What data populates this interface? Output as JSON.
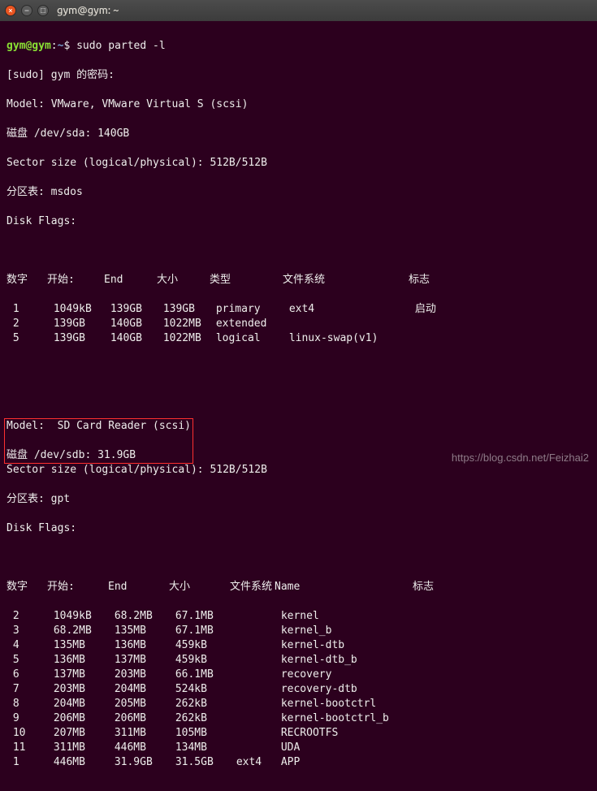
{
  "titlebar": {
    "title": "gym@gym: ~"
  },
  "prompt": {
    "userhost": "gym@gym",
    "sep": ":",
    "path": "~",
    "sigil": "$"
  },
  "command": "sudo parted -l",
  "sudo_line": "[sudo] gym 的密码:",
  "disk1": {
    "model": "Model: VMware, VMware Virtual S (scsi)",
    "disk": "磁盘 /dev/sda: 140GB",
    "sector": "Sector size (logical/physical): 512B/512B",
    "ptable": "分区表: msdos",
    "flags": "Disk Flags:",
    "headers": {
      "num": "数字",
      "start": "开始:",
      "end": "End",
      "size": "大小",
      "type": "类型",
      "fs": "文件系统",
      "flags": "标志"
    },
    "rows": [
      {
        "num": "1",
        "start": "1049kB",
        "end": "139GB",
        "size": "139GB",
        "type": "primary",
        "fs": "ext4",
        "flags": "启动"
      },
      {
        "num": "2",
        "start": "139GB",
        "end": "140GB",
        "size": "1022MB",
        "type": "extended",
        "fs": "",
        "flags": ""
      },
      {
        "num": "5",
        "start": "139GB",
        "end": "140GB",
        "size": "1022MB",
        "type": "logical",
        "fs": "linux-swap(v1)",
        "flags": ""
      }
    ]
  },
  "disk2": {
    "model": "Model:  SD Card Reader (scsi)",
    "disk": "磁盘 /dev/sdb: 31.9GB",
    "sector": "Sector size (logical/physical): 512B/512B",
    "ptable": "分区表: gpt",
    "flags": "Disk Flags:",
    "headers": {
      "num": "数字",
      "start": "开始:",
      "end": "End",
      "size": "大小",
      "fs": "文件系统",
      "name": "Name",
      "flags": "标志"
    },
    "rows": [
      {
        "num": "2",
        "start": "1049kB",
        "end": "68.2MB",
        "size": "67.1MB",
        "fs": "",
        "name": "kernel"
      },
      {
        "num": "3",
        "start": "68.2MB",
        "end": "135MB",
        "size": "67.1MB",
        "fs": "",
        "name": "kernel_b"
      },
      {
        "num": "4",
        "start": "135MB",
        "end": "136MB",
        "size": "459kB",
        "fs": "",
        "name": "kernel-dtb"
      },
      {
        "num": "5",
        "start": "136MB",
        "end": "137MB",
        "size": "459kB",
        "fs": "",
        "name": "kernel-dtb_b"
      },
      {
        "num": "6",
        "start": "137MB",
        "end": "203MB",
        "size": "66.1MB",
        "fs": "",
        "name": "recovery"
      },
      {
        "num": "7",
        "start": "203MB",
        "end": "204MB",
        "size": "524kB",
        "fs": "",
        "name": "recovery-dtb"
      },
      {
        "num": "8",
        "start": "204MB",
        "end": "205MB",
        "size": "262kB",
        "fs": "",
        "name": "kernel-bootctrl"
      },
      {
        "num": "9",
        "start": "206MB",
        "end": "206MB",
        "size": "262kB",
        "fs": "",
        "name": "kernel-bootctrl_b"
      },
      {
        "num": "10",
        "start": "207MB",
        "end": "311MB",
        "size": "105MB",
        "fs": "",
        "name": "RECROOTFS"
      },
      {
        "num": "11",
        "start": "311MB",
        "end": "446MB",
        "size": "134MB",
        "fs": "",
        "name": "UDA"
      },
      {
        "num": "1",
        "start": "446MB",
        "end": "31.9GB",
        "size": "31.5GB",
        "fs": "ext4",
        "name": "APP"
      }
    ]
  },
  "watermark": "https://blog.csdn.net/Feizhai2"
}
